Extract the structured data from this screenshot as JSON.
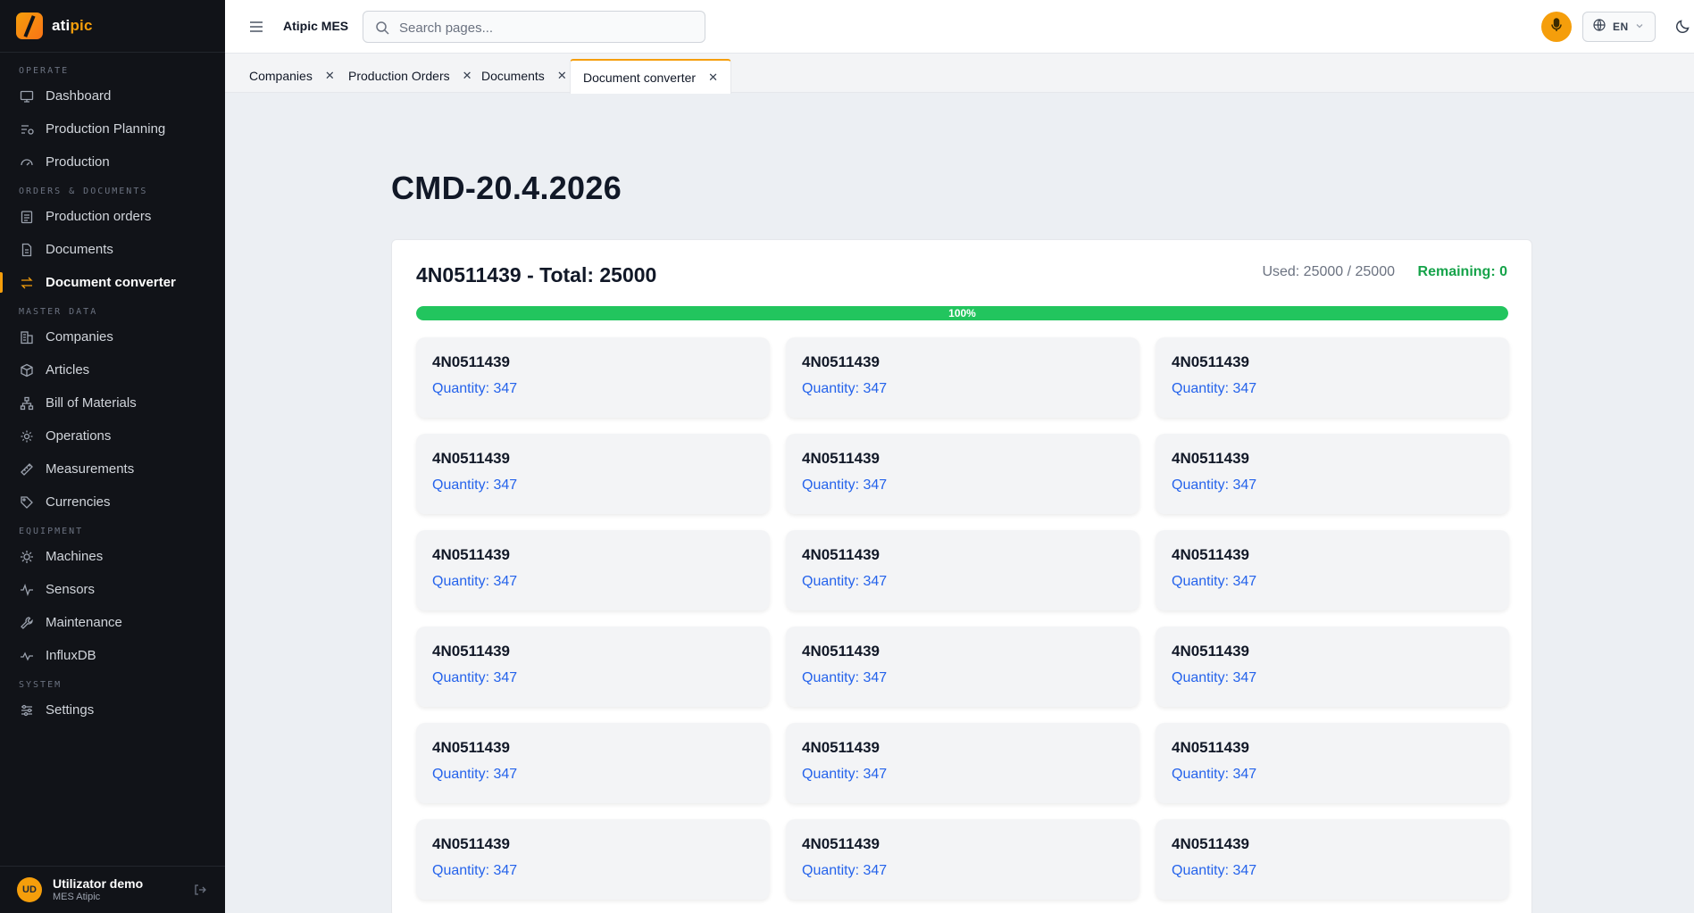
{
  "brand": {
    "name_a": "ati",
    "name_b": "pic"
  },
  "sidebar": {
    "sections": [
      {
        "title": "OPERATE",
        "items": [
          {
            "label": "Dashboard",
            "icon": "monitor-icon"
          },
          {
            "label": "Production Planning",
            "icon": "planning-icon"
          },
          {
            "label": "Production",
            "icon": "gauge-icon"
          }
        ]
      },
      {
        "title": "ORDERS & DOCUMENTS",
        "items": [
          {
            "label": "Production orders",
            "icon": "clipboard-icon"
          },
          {
            "label": "Documents",
            "icon": "document-icon"
          },
          {
            "label": "Document converter",
            "icon": "convert-icon",
            "active": true
          }
        ]
      },
      {
        "title": "MASTER DATA",
        "items": [
          {
            "label": "Companies",
            "icon": "building-icon"
          },
          {
            "label": "Articles",
            "icon": "box-icon"
          },
          {
            "label": "Bill of Materials",
            "icon": "hierarchy-icon"
          },
          {
            "label": "Operations",
            "icon": "gear-icon"
          },
          {
            "label": "Measurements",
            "icon": "ruler-icon"
          },
          {
            "label": "Currencies",
            "icon": "tag-icon"
          }
        ]
      },
      {
        "title": "EQUIPMENT",
        "items": [
          {
            "label": "Machines",
            "icon": "cog-icon"
          },
          {
            "label": "Sensors",
            "icon": "pulse-icon"
          },
          {
            "label": "Maintenance",
            "icon": "wrench-icon"
          },
          {
            "label": "InfluxDB",
            "icon": "activity-icon"
          }
        ]
      },
      {
        "title": "SYSTEM",
        "items": [
          {
            "label": "Settings",
            "icon": "sliders-icon"
          }
        ]
      }
    ]
  },
  "user": {
    "initials": "UD",
    "name": "Utilizator demo",
    "subtitle": "MES Atipic"
  },
  "topbar": {
    "app_title": "Atipic MES",
    "search_placeholder": "Search pages...",
    "language": "EN"
  },
  "tabs": [
    {
      "label": "Companies"
    },
    {
      "label": "Production Orders"
    },
    {
      "label": "Documents"
    },
    {
      "label": "Document converter",
      "active": true
    }
  ],
  "main": {
    "title": "CMD-20.4.2026",
    "panel": {
      "heading": "4N0511439 - Total: 25000",
      "used": "Used: 25000 / 25000",
      "remaining": "Remaining: 0",
      "progress_label": "100%",
      "progress_fraction": 1.0,
      "cards": [
        {
          "code": "4N0511439",
          "quantity": "Quantity: 347"
        },
        {
          "code": "4N0511439",
          "quantity": "Quantity: 347"
        },
        {
          "code": "4N0511439",
          "quantity": "Quantity: 347"
        },
        {
          "code": "4N0511439",
          "quantity": "Quantity: 347"
        },
        {
          "code": "4N0511439",
          "quantity": "Quantity: 347"
        },
        {
          "code": "4N0511439",
          "quantity": "Quantity: 347"
        },
        {
          "code": "4N0511439",
          "quantity": "Quantity: 347"
        },
        {
          "code": "4N0511439",
          "quantity": "Quantity: 347"
        },
        {
          "code": "4N0511439",
          "quantity": "Quantity: 347"
        },
        {
          "code": "4N0511439",
          "quantity": "Quantity: 347"
        },
        {
          "code": "4N0511439",
          "quantity": "Quantity: 347"
        },
        {
          "code": "4N0511439",
          "quantity": "Quantity: 347"
        },
        {
          "code": "4N0511439",
          "quantity": "Quantity: 347"
        },
        {
          "code": "4N0511439",
          "quantity": "Quantity: 347"
        },
        {
          "code": "4N0511439",
          "quantity": "Quantity: 347"
        },
        {
          "code": "4N0511439",
          "quantity": "Quantity: 347"
        },
        {
          "code": "4N0511439",
          "quantity": "Quantity: 347"
        },
        {
          "code": "4N0511439",
          "quantity": "Quantity: 347"
        }
      ]
    }
  },
  "colors": {
    "accent": "#f59e0b",
    "success": "#22c55e",
    "link": "#2563eb",
    "sidebar_bg": "#111318"
  }
}
